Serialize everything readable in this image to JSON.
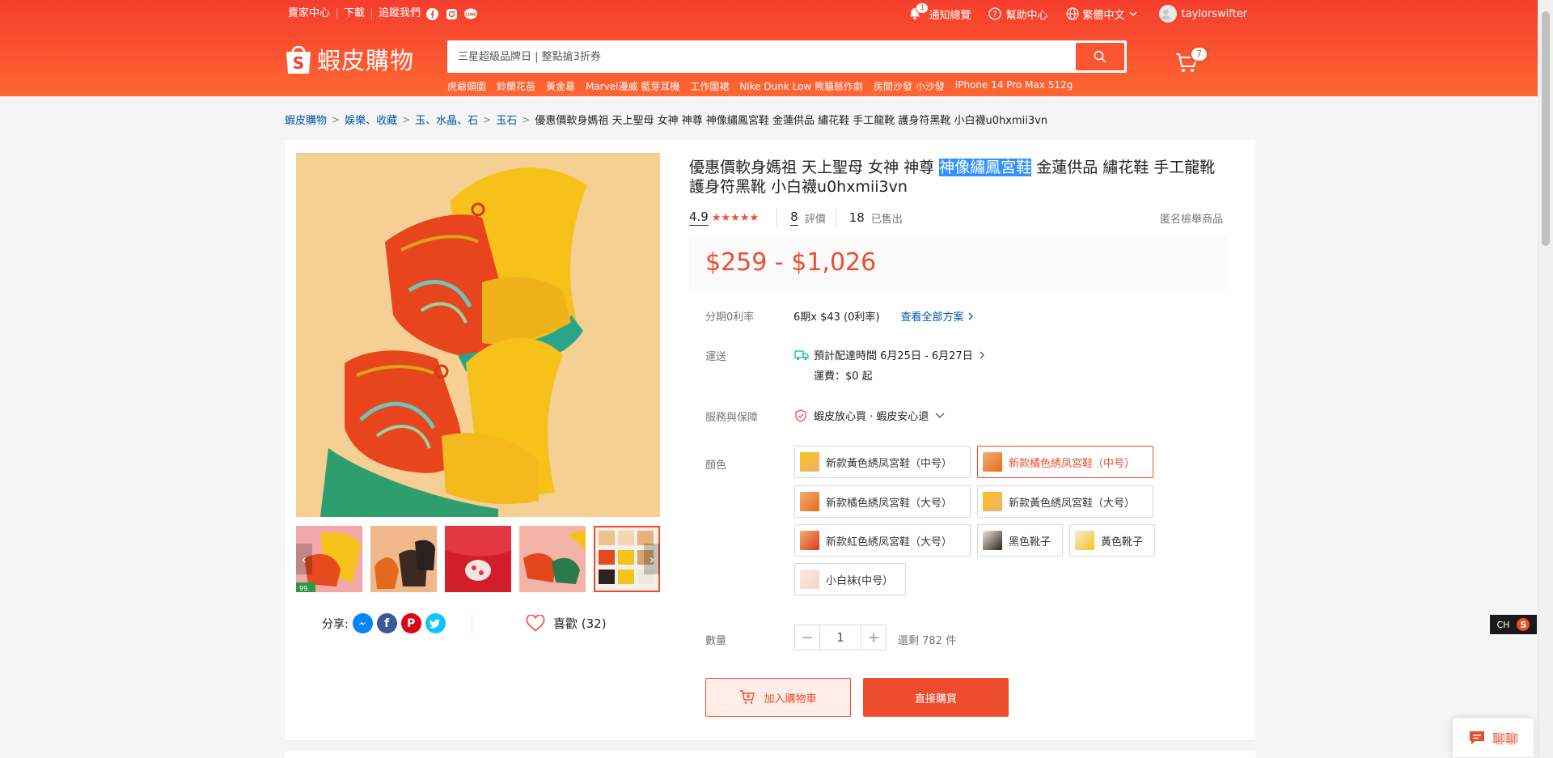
{
  "header": {
    "topbar": {
      "seller_center": "賣家中心",
      "download": "下載",
      "follow_us": "追蹤我們",
      "notifications": "通知總覽",
      "notification_count": "1",
      "help": "幫助中心",
      "language": "繁體中文",
      "username": "taylorswifter"
    },
    "logo_text": "蝦皮購物",
    "search": {
      "placeholder": "三星超級品牌日 | 整點搶3折券"
    },
    "hot_words": [
      "虎爺頭圍",
      "鈴蘭花苗",
      "黃金葛",
      "Marvel漫威 藍芽耳機",
      "工作圍裙",
      "Nike Dunk Low 熊貓慈作劇",
      "房間沙發 小沙發",
      "iPhone 14 Pro Max 512g"
    ],
    "cart_count": "7"
  },
  "breadcrumb": {
    "items": [
      "蝦皮購物",
      "娛樂、收藏",
      "玉、水晶、石",
      "玉石"
    ],
    "current": "優惠價軟身媽祖 天上聖母 女神 神尊 神像繡鳳宮鞋 金蓮供品 繡花鞋 手工龍靴 護身符黑靴 小白襪u0hxmii3vn"
  },
  "product": {
    "title_before": "優惠價軟身媽祖 天上聖母 女神 神尊 ",
    "title_highlight": "神像繡鳳宮鞋",
    "title_after": " 金蓮供品 繡花鞋 手工龍靴 護身符黑靴 小白襪u0hxmii3vn",
    "rating": "4.9",
    "stars": "★★★★★",
    "review_count": "8",
    "review_label": "評價",
    "sold_count": "18",
    "sold_label": "已售出",
    "report": "匿名檢舉商品",
    "price": "$259 - $1,026",
    "installment_label": "分期0利率",
    "installment_value": "6期x $43 (0利率)",
    "installment_link": "查看全部方案",
    "shipping_label": "運送",
    "shipping_eta": "預計配達時間 6月25日 - 6月27日",
    "shipping_fee": "運費：$0 起",
    "service_label": "服務與保障",
    "service_value": "蝦皮放心買 · 蝦皮安心退",
    "color_label": "顏色",
    "options": [
      {
        "label": "新款黃色綉凤宮鞋（中号）",
        "selected": false
      },
      {
        "label": "新款橘色綉凤宮鞋（中号）",
        "selected": true
      },
      {
        "label": "新款橘色綉凤宮鞋（大号）",
        "selected": false
      },
      {
        "label": "新款黃色綉凤宮鞋（大号）",
        "selected": false
      },
      {
        "label": "新款紅色綉凤宮鞋（大号）",
        "selected": false
      },
      {
        "label": "黑色靴子",
        "selected": false
      },
      {
        "label": "黃色靴子",
        "selected": false
      },
      {
        "label": "小白袜(中号）",
        "selected": false
      }
    ],
    "quantity_label": "數量",
    "quantity": "1",
    "stock": "還剩 782 件",
    "add_to_cart": "加入購物車",
    "buy_now": "直接購買",
    "share_label": "分享:",
    "like_label": "喜歡 (32)",
    "thumb_badge": "99."
  },
  "ime": {
    "label": "CH",
    "icon": "S"
  },
  "chat_label": "聊聊",
  "colors": {
    "brand": "#ee4d2d",
    "link": "#0055aa"
  }
}
